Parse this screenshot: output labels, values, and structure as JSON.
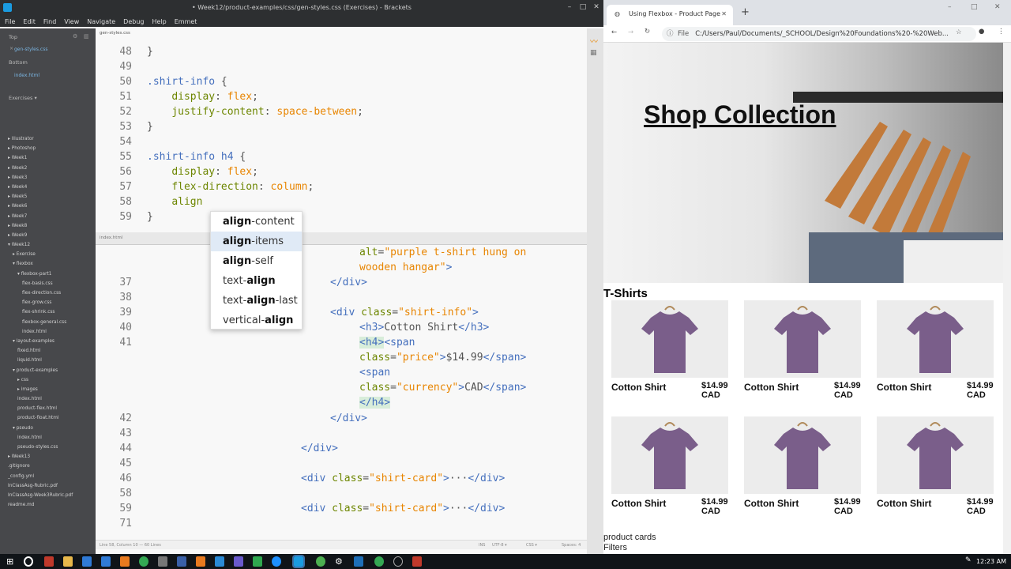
{
  "brackets": {
    "title": "• Week12/product-examples/css/gen-styles.css (Exercises) - Brackets",
    "menu": [
      "File",
      "Edit",
      "Find",
      "View",
      "Navigate",
      "Debug",
      "Help",
      "Emmet"
    ],
    "sidebar": {
      "working_top_label": "Top",
      "working_top_file": "gen-styles.css",
      "working_bottom_label": "Bottom",
      "working_bottom_file": "index.html",
      "project_label": "Exercises ▾",
      "tree": [
        {
          "label": "▸ Illustrator",
          "indent": 0
        },
        {
          "label": "▸ Photoshop",
          "indent": 0
        },
        {
          "label": "▸ Week1",
          "indent": 0
        },
        {
          "label": "▸ Week2",
          "indent": 0
        },
        {
          "label": "▸ Week3",
          "indent": 0
        },
        {
          "label": "▸ Week4",
          "indent": 0
        },
        {
          "label": "▸ Week5",
          "indent": 0
        },
        {
          "label": "▸ Week6",
          "indent": 0
        },
        {
          "label": "▸ Week7",
          "indent": 0
        },
        {
          "label": "▸ Week8",
          "indent": 0
        },
        {
          "label": "▸ Week9",
          "indent": 0
        },
        {
          "label": "▾ Week12",
          "indent": 0
        },
        {
          "label": "▸ Exercise",
          "indent": 1
        },
        {
          "label": "▾ flexbox",
          "indent": 1
        },
        {
          "label": "▾ flexbox-part1",
          "indent": 2
        },
        {
          "label": "flex-basis.css",
          "indent": 3
        },
        {
          "label": "flex-direction.css",
          "indent": 3
        },
        {
          "label": "flex-grow.css",
          "indent": 3
        },
        {
          "label": "flex-shrink.css",
          "indent": 3
        },
        {
          "label": "flexbox-general.css",
          "indent": 3
        },
        {
          "label": "index.html",
          "indent": 3
        },
        {
          "label": "▾ layout-examples",
          "indent": 1
        },
        {
          "label": "fixed.html",
          "indent": 2
        },
        {
          "label": "liquid.html",
          "indent": 2
        },
        {
          "label": "▾ product-examples",
          "indent": 1
        },
        {
          "label": "▸ css",
          "indent": 2
        },
        {
          "label": "▸ images",
          "indent": 2
        },
        {
          "label": "index.html",
          "indent": 2
        },
        {
          "label": "product-flex.html",
          "indent": 2
        },
        {
          "label": "product-float.html",
          "indent": 2
        },
        {
          "label": "▾ pseudo",
          "indent": 1
        },
        {
          "label": "index.html",
          "indent": 2
        },
        {
          "label": "pseudo-styles.css",
          "indent": 2
        },
        {
          "label": "▸ Week13",
          "indent": 0
        },
        {
          "label": ".gitignore",
          "indent": 0
        },
        {
          "label": "_config.yml",
          "indent": 0
        },
        {
          "label": "InClassAsg-Rubric.pdf",
          "indent": 0
        },
        {
          "label": "InClassAsg-Week3Rubric.pdf",
          "indent": 0
        },
        {
          "label": "readme.md",
          "indent": 0
        }
      ]
    },
    "tab_name": "gen-styles.css",
    "inline_editor_name": "index.html",
    "autocomplete": [
      {
        "bold": "align",
        "rest": "-content"
      },
      {
        "bold": "align",
        "rest": "-items"
      },
      {
        "bold": "align",
        "rest": "-self"
      },
      {
        "pre": "text-",
        "bold": "align",
        "rest": ""
      },
      {
        "pre": "text-",
        "bold": "align",
        "rest": "-last"
      },
      {
        "pre": "vertical-",
        "bold": "align",
        "rest": ""
      }
    ],
    "status_left": "Line 58, Column 10 — 60 Lines",
    "status_right": [
      "INS",
      "UTF-8 ▾",
      "CSS ▾",
      "Spaces: 4"
    ]
  },
  "chrome": {
    "tab_title": "Using Flexbox - Product Page",
    "new_tab": "+",
    "address_prefix": "File",
    "address": "C:/Users/Paul/Documents/_SCHOOL/Design%20Foundations%20-%20Web...",
    "page": {
      "hero_title": "Shop Collection",
      "section_title": "T-Shirts",
      "cards": [
        {
          "name": "Cotton Shirt",
          "price": "$14.99",
          "currency": "CAD"
        },
        {
          "name": "Cotton Shirt",
          "price": "$14.99",
          "currency": "CAD"
        },
        {
          "name": "Cotton Shirt",
          "price": "$14.99",
          "currency": "CAD"
        },
        {
          "name": "Cotton Shirt",
          "price": "$14.99",
          "currency": "CAD"
        },
        {
          "name": "Cotton Shirt",
          "price": "$14.99",
          "currency": "CAD"
        },
        {
          "name": "Cotton Shirt",
          "price": "$14.99",
          "currency": "CAD"
        }
      ],
      "footer_lines": [
        "product cards",
        "Filters"
      ]
    }
  },
  "taskbar": {
    "clock": "12:23 AM"
  },
  "colors": {
    "brackets_sidebar": "#47484b",
    "shirt": "#7a5e8a",
    "chrome_tabbar": "#dee1e6"
  }
}
